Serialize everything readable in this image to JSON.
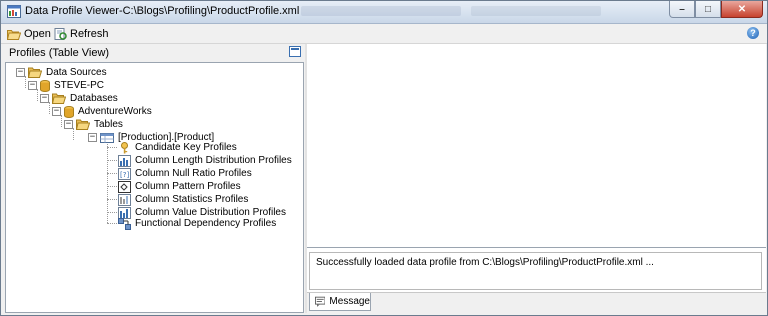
{
  "window": {
    "title": "Data Profile Viewer-C:\\Blogs\\Profiling\\ProductProfile.xml",
    "minimize_symbol": "–",
    "maximize_symbol": "□",
    "close_symbol": "✕"
  },
  "toolbar": {
    "open_label": "Open",
    "refresh_label": "Refresh",
    "help_symbol": "?"
  },
  "left_panel": {
    "header": "Profiles (Table View)"
  },
  "tree": {
    "expand_symbol": "−",
    "data_sources": "Data Sources",
    "server": "STEVE-PC",
    "databases": "Databases",
    "database": "AdventureWorks",
    "tables": "Tables",
    "table": "[Production].[Product]",
    "profiles": [
      {
        "label": "Candidate Key Profiles",
        "icon": "key-icon"
      },
      {
        "label": "Column Length Distribution Profiles",
        "icon": "length-distribution-icon"
      },
      {
        "label": "Column Null Ratio Profiles",
        "icon": "null-ratio-icon"
      },
      {
        "label": "Column Pattern Profiles",
        "icon": "pattern-icon"
      },
      {
        "label": "Column Statistics Profiles",
        "icon": "statistics-icon"
      },
      {
        "label": "Column Value Distribution Profiles",
        "icon": "value-distribution-icon"
      },
      {
        "label": "Functional Dependency Profiles",
        "icon": "dependency-icon"
      }
    ]
  },
  "message_panel": {
    "text": "Successfully loaded data profile from C:\\Blogs\\Profiling\\ProductProfile.xml ...",
    "tab_label": "Message"
  },
  "colors": {
    "folder": "#e8b84a",
    "database": "#e0a52a",
    "accent": "#1b5fb5"
  }
}
